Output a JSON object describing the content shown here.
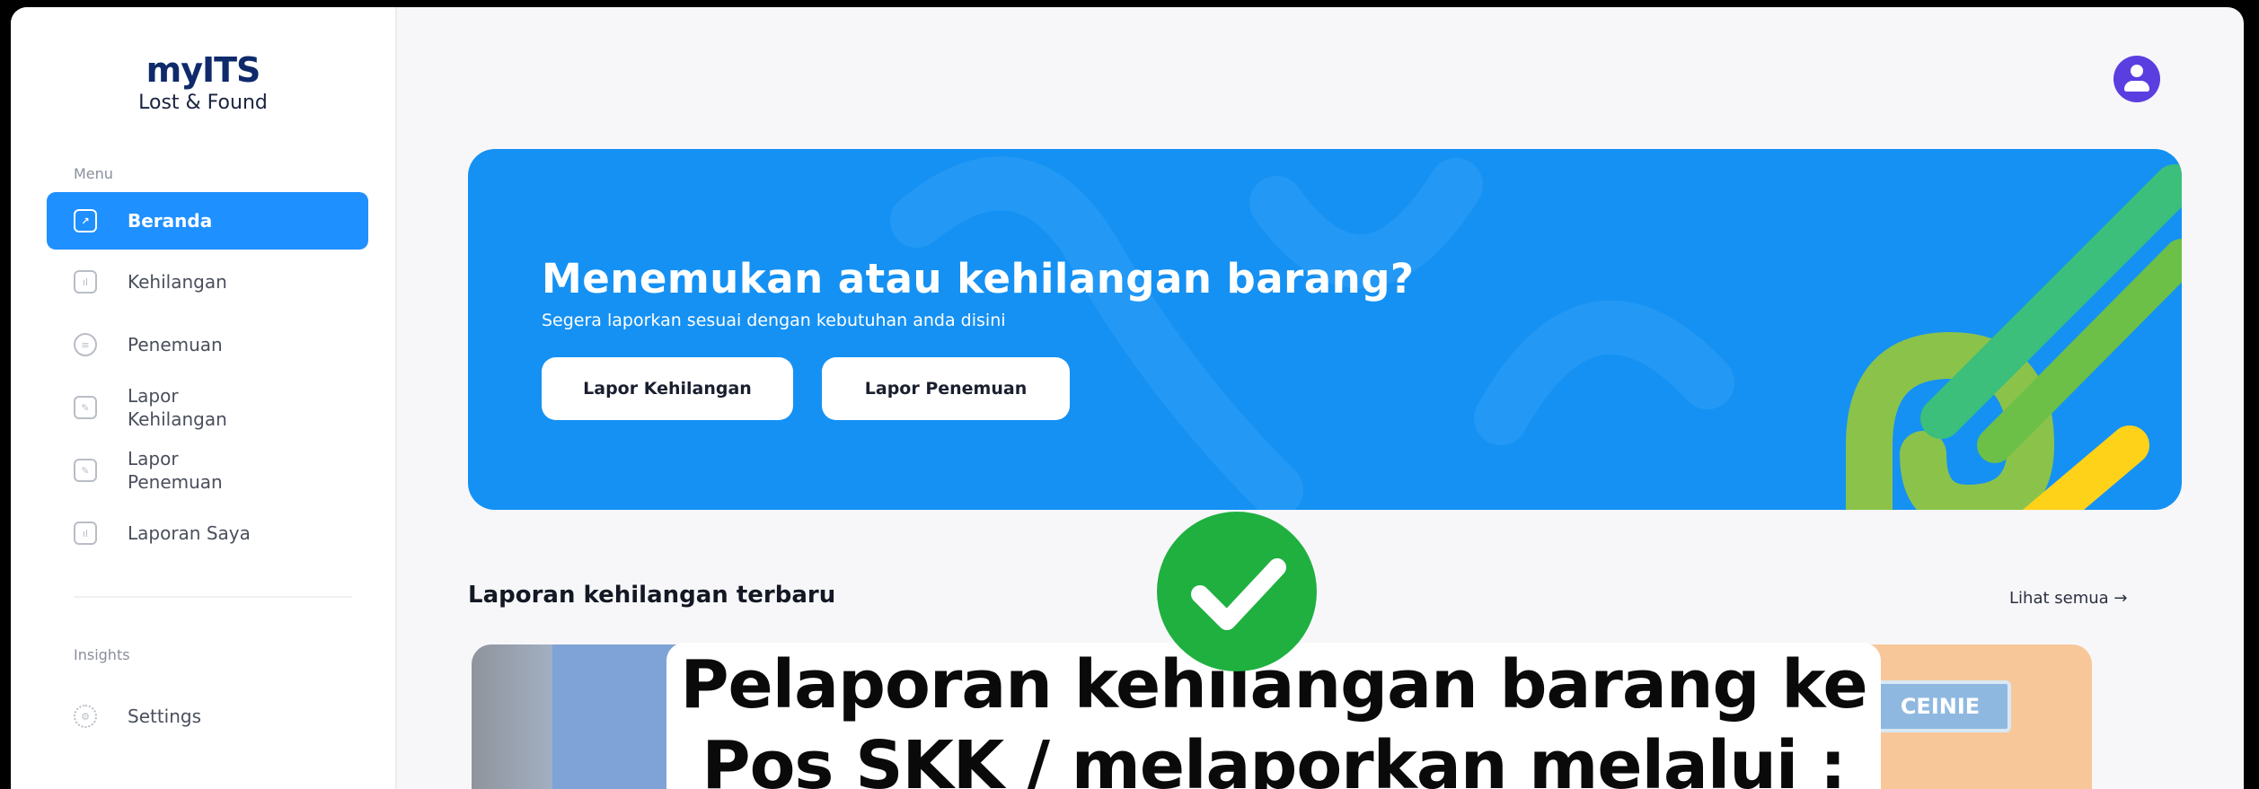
{
  "brand": {
    "name": "myITS",
    "subtitle": "Lost & Found"
  },
  "sidebar": {
    "menu_label": "Menu",
    "items": [
      {
        "label": "Beranda",
        "icon": "chart-icon",
        "active": true
      },
      {
        "label": "Kehilangan",
        "icon": "bar-chart-icon",
        "active": false
      },
      {
        "label": "Penemuan",
        "icon": "coin-icon",
        "active": false
      },
      {
        "label": "Lapor Kehilangan",
        "icon": "report-icon",
        "active": false
      },
      {
        "label": "Lapor Penemuan",
        "icon": "report-icon",
        "active": false
      },
      {
        "label": "Laporan Saya",
        "icon": "bar-chart-icon",
        "active": false
      }
    ],
    "insights_label": "Insights",
    "settings_label": "Settings"
  },
  "hero": {
    "title": "Menemukan atau kehilangan barang?",
    "subtitle": "Segera laporkan sesuai dengan kebutuhan anda disini",
    "btn_lost": "Lapor Kehilangan",
    "btn_found": "Lapor Penemuan"
  },
  "recent": {
    "title": "Laporan kehilangan terbaru",
    "see_all": "Lihat semua →",
    "card3_label": "CEINIE"
  },
  "overlay": {
    "line1": "Pelaporan kehilangan barang ke",
    "line2": "Pos SKK / melaporkan melalui :"
  },
  "colors": {
    "accent": "#1e90ff",
    "success": "#1fb040",
    "avatar": "#5b3ee0"
  }
}
